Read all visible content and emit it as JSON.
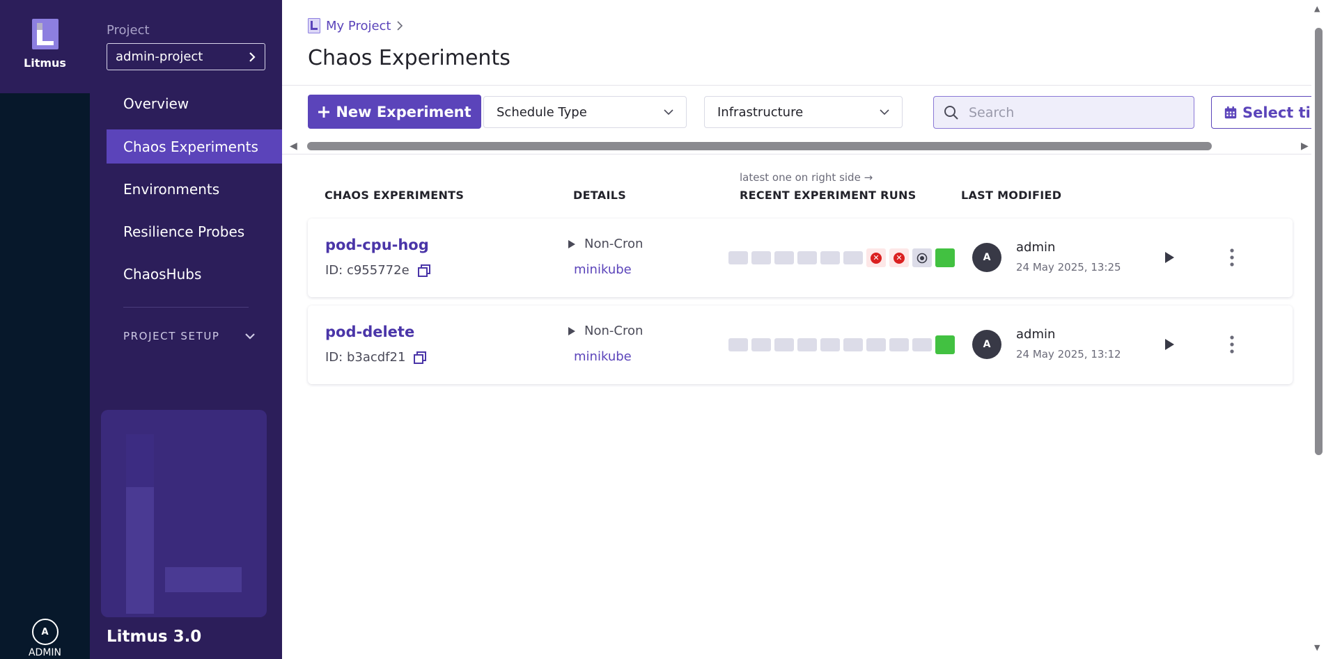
{
  "rail": {
    "app_name": "Litmus",
    "user_initial": "A",
    "user_label": "ADMIN"
  },
  "sidebar": {
    "project_label": "Project",
    "project_name": "admin-project",
    "items": [
      {
        "label": "Overview",
        "active": false
      },
      {
        "label": "Chaos Experiments",
        "active": true
      },
      {
        "label": "Environments",
        "active": false
      },
      {
        "label": "Resilience Probes",
        "active": false
      },
      {
        "label": "ChaosHubs",
        "active": false
      }
    ],
    "setup_label": "PROJECT SETUP",
    "version": "Litmus 3.0"
  },
  "header": {
    "breadcrumb": "My Project",
    "title": "Chaos Experiments"
  },
  "toolbar": {
    "new_label": "New Experiment",
    "schedule_label": "Schedule Type",
    "infra_label": "Infrastructure",
    "search_placeholder": "Search",
    "time_label": "Select time"
  },
  "table": {
    "hint": "latest one on right side →",
    "columns": {
      "experiments": "CHAOS EXPERIMENTS",
      "details": "DETAILS",
      "runs": "RECENT EXPERIMENT RUNS",
      "modified": "LAST MODIFIED"
    },
    "rows": [
      {
        "name": "pod-cpu-hog",
        "id": "ID: c955772e",
        "schedule": "Non-Cron",
        "infra": "minikube",
        "runs": [
          "empty",
          "empty",
          "empty",
          "empty",
          "empty",
          "empty",
          "failed",
          "failed",
          "stopped",
          "success"
        ],
        "avatar": "A",
        "user": "admin",
        "time": "24 May 2025, 13:25"
      },
      {
        "name": "pod-delete",
        "id": "ID: b3acdf21",
        "schedule": "Non-Cron",
        "infra": "minikube",
        "runs": [
          "empty",
          "empty",
          "empty",
          "empty",
          "empty",
          "empty",
          "empty",
          "empty",
          "empty",
          "success"
        ],
        "avatar": "A",
        "user": "admin",
        "time": "24 May 2025, 13:12"
      }
    ]
  },
  "colors": {
    "brand": "#5b44ba",
    "sidebar": "#2c1e5a",
    "rail": "#07182b",
    "success": "#42c141",
    "failed": "#da2020"
  }
}
